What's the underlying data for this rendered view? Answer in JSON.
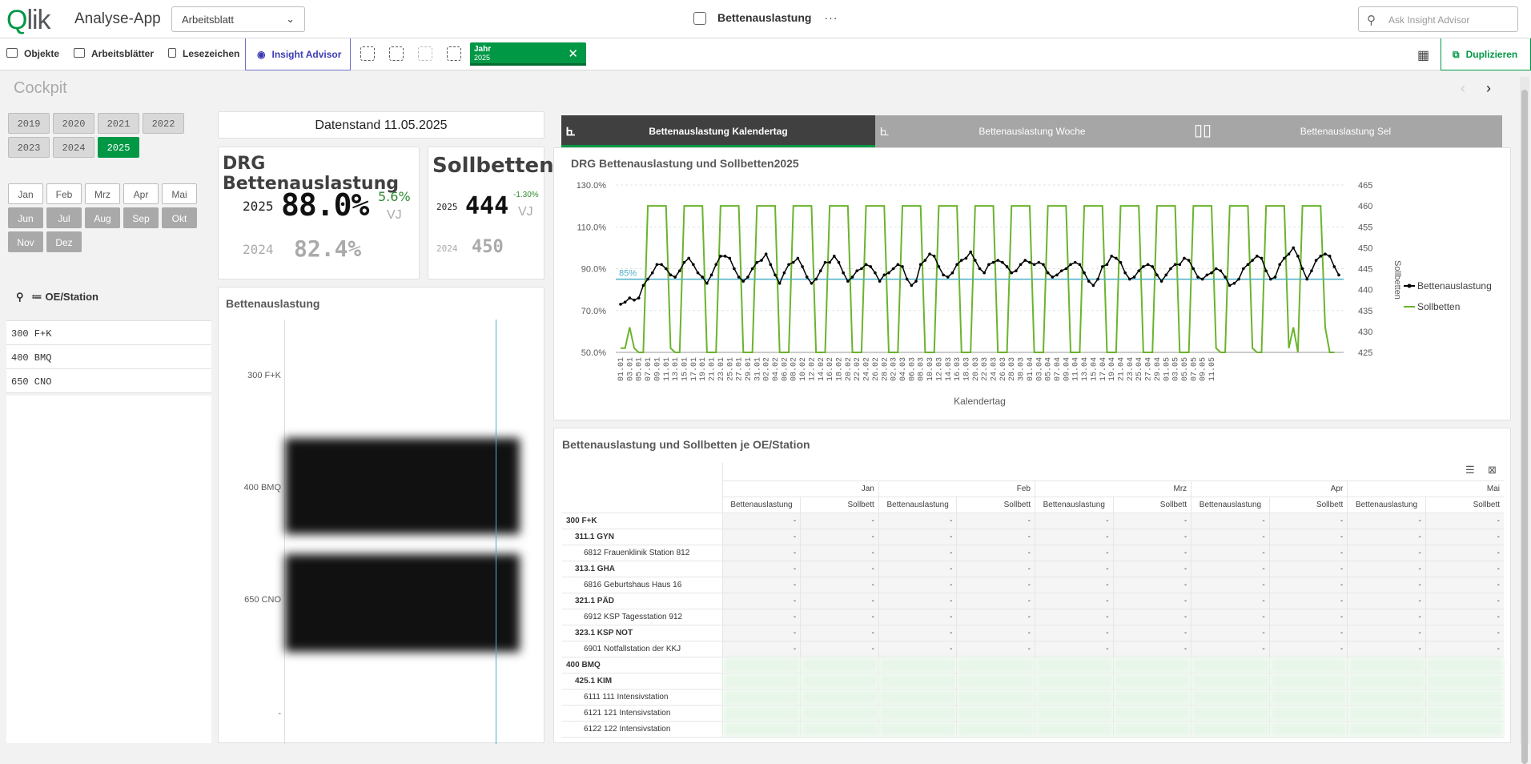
{
  "app": {
    "logo": "Qlik",
    "name": "Analyse-App",
    "sheet_selector": "Arbeitsblatt",
    "sheet_title": "Bettenauslastung",
    "more": "···",
    "search_placeholder": "Ask Insight Advisor"
  },
  "toolbar": {
    "objekte": "Objekte",
    "arbeitsblaetter": "Arbeitsblätter",
    "lesezeichen": "Lesezeichen",
    "insight": "Insight Advisor",
    "selection_field": "Jahr",
    "selection_value": "2025",
    "duplicate": "Duplizieren"
  },
  "page": {
    "title": "Cockpit"
  },
  "years": [
    "2019",
    "2020",
    "2021",
    "2022",
    "2023",
    "2024",
    "2025"
  ],
  "selected_year": "2025",
  "months": [
    "Jan",
    "Feb",
    "Mrz",
    "Apr",
    "Mai",
    "Jun",
    "Jul",
    "Aug",
    "Sep",
    "Okt",
    "Nov",
    "Dez"
  ],
  "oe_filter": {
    "title": "OE/Station",
    "items": [
      "300 F+K",
      "400 BMQ",
      "650 CNO"
    ]
  },
  "datenstand": "Datenstand 11.05.2025",
  "kpi_drg": {
    "title": "DRG Bettenauslastung",
    "year_current": "2025",
    "value_current": "88.0%",
    "delta": "5.6%",
    "delta_label": "VJ",
    "year_prev": "2024",
    "value_prev": "82.4%"
  },
  "kpi_soll": {
    "title": "Sollbetten",
    "year_current": "2025",
    "value_current": "444",
    "delta": "-1.30%",
    "delta_label": "VJ",
    "year_prev": "2024",
    "value_prev": "450"
  },
  "bar_panel": {
    "title": "Bettenauslastung",
    "categories": [
      "300 F+K",
      "400 BMQ",
      "650 CNO",
      "-"
    ]
  },
  "tabs": [
    "Bettenauslastung Kalendertag",
    "Bettenauslastung Woche",
    "Bettenauslastung Sel"
  ],
  "line_chart": {
    "title": "DRG Bettenauslastung und Sollbetten2025",
    "xlabel": "Kalendertag",
    "ylabel_right": "Sollbetten",
    "ref_label": "85%",
    "left_ticks": [
      "130.0%",
      "110.0%",
      "90.0%",
      "70.0%",
      "50.0%"
    ],
    "right_ticks": [
      "465",
      "460",
      "455",
      "450",
      "445",
      "440",
      "435",
      "430",
      "425"
    ],
    "x_ticks": [
      "01.01",
      "03.01",
      "05.01",
      "07.01",
      "09.01",
      "11.01",
      "13.01",
      "15.01",
      "17.01",
      "19.01",
      "21.01",
      "23.01",
      "25.01",
      "27.01",
      "29.01",
      "31.01",
      "02.02",
      "04.02",
      "06.02",
      "08.02",
      "10.02",
      "12.02",
      "14.02",
      "16.02",
      "18.02",
      "20.02",
      "22.02",
      "24.02",
      "26.02",
      "28.02",
      "02.03",
      "04.03",
      "06.03",
      "08.03",
      "10.03",
      "12.03",
      "14.03",
      "16.03",
      "18.03",
      "20.03",
      "22.03",
      "24.03",
      "26.03",
      "28.03",
      "30.03",
      "01.04",
      "03.04",
      "05.04",
      "07.04",
      "09.04",
      "11.04",
      "13.04",
      "15.04",
      "17.04",
      "19.04",
      "21.04",
      "23.04",
      "25.04",
      "27.04",
      "29.04",
      "01.05",
      "03.05",
      "05.05",
      "07.05",
      "09.05",
      "11.05"
    ],
    "legend": [
      "Bettenauslastung",
      "Sollbetten"
    ],
    "colors": {
      "auslastung": "#000000",
      "sollbetten": "#6ab42d",
      "reference": "#4bb0c8"
    }
  },
  "chart_data": {
    "type": "line",
    "title": "DRG Bettenauslastung und Sollbetten2025",
    "xlabel": "Kalendertag",
    "ylabel": "",
    "ylim": [
      50,
      130
    ],
    "y2label": "Sollbetten",
    "y2lim": [
      425,
      465
    ],
    "reference_line": {
      "label": "85%",
      "value": 85
    },
    "series": [
      {
        "name": "Bettenauslastung",
        "axis": "left",
        "values": [
          73,
          74,
          76,
          75,
          76,
          82,
          85,
          88,
          92,
          92,
          90,
          87,
          86,
          89,
          93,
          95,
          92,
          88,
          86,
          83,
          87,
          92,
          96,
          96,
          95,
          90,
          86,
          84,
          86,
          90,
          93,
          94,
          97,
          92,
          87,
          83,
          88,
          92,
          93,
          95,
          91,
          86,
          83,
          85,
          89,
          93,
          93,
          96,
          93,
          88,
          84,
          86,
          89,
          90,
          92,
          91,
          88,
          84,
          87,
          88,
          90,
          92,
          91,
          85,
          82,
          84,
          92,
          94,
          97,
          96,
          91,
          87,
          86,
          88,
          92,
          94,
          95,
          98,
          94,
          90,
          88,
          92,
          93,
          94,
          93,
          91,
          88,
          89,
          92,
          94,
          93,
          92,
          93,
          92,
          88,
          86,
          87,
          89,
          90,
          92,
          93,
          92,
          88,
          84,
          82,
          85,
          91,
          92,
          96,
          95,
          93,
          88,
          85,
          86,
          89,
          91,
          92,
          91,
          87,
          84,
          87,
          90,
          92,
          92,
          95,
          94,
          90,
          86,
          85,
          87,
          88,
          90,
          89,
          86,
          82,
          83,
          85,
          90,
          92,
          94,
          96,
          95,
          89,
          85,
          86,
          92,
          95,
          97,
          100,
          96,
          90,
          85,
          89,
          94,
          96,
          97,
          96,
          91,
          87
        ]
      },
      {
        "name": "Sollbetten",
        "axis": "right",
        "values": [
          426,
          426,
          431,
          426,
          425,
          425,
          460,
          460,
          460,
          460,
          460,
          426,
          425,
          425,
          460,
          460,
          460,
          460,
          460,
          425,
          425,
          425,
          460,
          460,
          460,
          460,
          460,
          425,
          425,
          425,
          460,
          460,
          460,
          460,
          460,
          425,
          425,
          425,
          460,
          460,
          460,
          460,
          460,
          425,
          425,
          425,
          460,
          460,
          460,
          460,
          460,
          425,
          425,
          425,
          460,
          460,
          460,
          460,
          460,
          425,
          425,
          425,
          460,
          460,
          460,
          460,
          460,
          425,
          425,
          425,
          460,
          460,
          460,
          460,
          460,
          425,
          425,
          425,
          460,
          460,
          460,
          460,
          460,
          425,
          425,
          425,
          460,
          460,
          460,
          460,
          460,
          425,
          425,
          425,
          460,
          460,
          460,
          460,
          460,
          425,
          425,
          425,
          460,
          460,
          460,
          460,
          460,
          425,
          425,
          425,
          460,
          460,
          460,
          460,
          460,
          425,
          425,
          425,
          460,
          460,
          460,
          460,
          460,
          425,
          425,
          425,
          460,
          460,
          460,
          460,
          460,
          426,
          425,
          425,
          460,
          460,
          460,
          460,
          460,
          426,
          425,
          425,
          460,
          460,
          460,
          460,
          460,
          426,
          431,
          425,
          460,
          460,
          460,
          460,
          460,
          431,
          425,
          425
        ]
      }
    ]
  },
  "pivot": {
    "title": "Bettenauslastung und Sollbetten je OE/Station",
    "months": [
      "Jan",
      "Feb",
      "Mrz",
      "Apr",
      "Mai"
    ],
    "measures": [
      "Bettenauslastung",
      "Sollbett"
    ],
    "rows": [
      {
        "label": "300 F+K",
        "level": 0,
        "blurred": false
      },
      {
        "label": "311.1 GYN",
        "level": 1,
        "blurred": false
      },
      {
        "label": "6812 Frauenklinik Station 812",
        "level": 2,
        "blurred": false
      },
      {
        "label": "313.1 GHA",
        "level": 1,
        "blurred": false
      },
      {
        "label": "6816 Geburtshaus Haus 16",
        "level": 2,
        "blurred": false
      },
      {
        "label": "321.1 PÄD",
        "level": 1,
        "blurred": false
      },
      {
        "label": "6912 KSP Tagesstation 912",
        "level": 2,
        "blurred": false
      },
      {
        "label": "323.1 KSP NOT",
        "level": 1,
        "blurred": false
      },
      {
        "label": "6901 Notfallstation der KKJ",
        "level": 2,
        "blurred": false
      },
      {
        "label": "400 BMQ",
        "level": 0,
        "blurred": true
      },
      {
        "label": "425.1 KIM",
        "level": 1,
        "blurred": true
      },
      {
        "label": "6111 111 Intensivstation",
        "level": 2,
        "blurred": true
      },
      {
        "label": "6121 121 Intensivstation",
        "level": 2,
        "blurred": true
      },
      {
        "label": "6122 122 Intensivstation",
        "level": 2,
        "blurred": true
      }
    ],
    "dash": "-"
  }
}
